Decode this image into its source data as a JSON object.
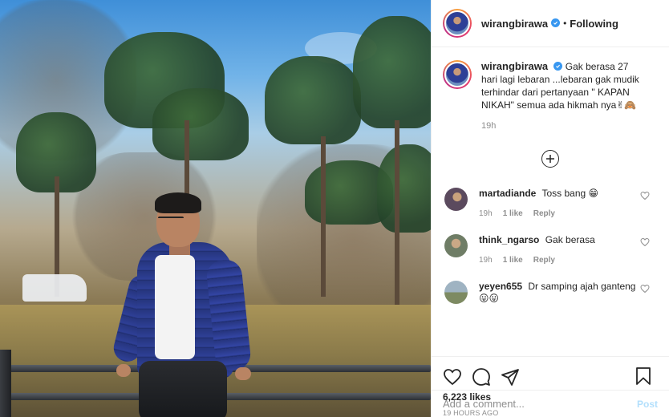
{
  "header": {
    "username": "wirangbirawa",
    "separator": "•",
    "follow_status": "Following"
  },
  "caption": {
    "username": "wirangbirawa",
    "text": "Gak berasa 27 hari lagi lebaran ...lebaran gak mudik terhindar dari pertanyaan \" KAPAN NIKAH\" semua ada hikmah nya✌🙈",
    "time": "19h"
  },
  "comments": [
    {
      "username": "martadiande",
      "text": "Toss bang 😁",
      "time": "19h",
      "likes": "1 like",
      "reply": "Reply",
      "avatar_color": "#5b4a5e"
    },
    {
      "username": "think_ngarso",
      "text": "Gak berasa",
      "time": "19h",
      "likes": "1 like",
      "reply": "Reply",
      "avatar_color": "#7b8770"
    },
    {
      "username": "yeyen655",
      "text": "Dr samping ajah ganteng😛😛",
      "avatar_color": "#8b9aa6"
    }
  ],
  "actions": {
    "icons": [
      "heart-icon",
      "comment-icon",
      "share-icon",
      "bookmark-icon"
    ]
  },
  "likes_count": "6,223 likes",
  "time_ago": "19 HOURS AGO",
  "add_comment": {
    "placeholder": "Add a comment...",
    "post_label": "Post"
  },
  "colors": {
    "verified": "#3897f0",
    "post_button_disabled": "#b2dffc",
    "muted_text": "#8e8e8e"
  }
}
